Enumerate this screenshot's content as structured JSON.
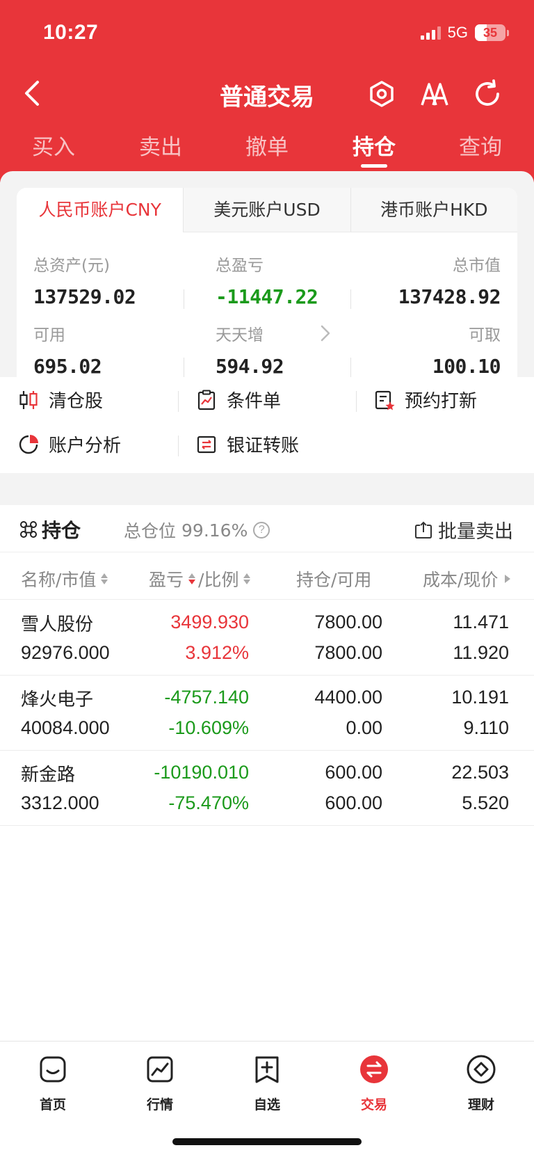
{
  "status": {
    "time": "10:27",
    "network": "5G",
    "battery": "35"
  },
  "nav": {
    "title": "普通交易"
  },
  "tabs": [
    {
      "label": "买入"
    },
    {
      "label": "卖出"
    },
    {
      "label": "撤单"
    },
    {
      "label": "持仓"
    },
    {
      "label": "查询"
    }
  ],
  "active_tab": "持仓",
  "account_tabs": [
    {
      "label": "人民币账户CNY"
    },
    {
      "label": "美元账户USD"
    },
    {
      "label": "港币账户HKD"
    }
  ],
  "stats": {
    "total_assets_label": "总资产(元)",
    "total_assets": "137529.02",
    "total_pnl_label": "总盈亏",
    "total_pnl": "-11447.22",
    "market_value_label": "总市值",
    "market_value": "137428.92",
    "available_label": "可用",
    "available": "695.02",
    "tiantianzeng_label": "天天增",
    "tiantianzeng": "594.92",
    "withdrawable_label": "可取",
    "withdrawable": "100.10"
  },
  "functions": [
    {
      "label": "清仓股",
      "icon": "candlestick-icon"
    },
    {
      "label": "条件单",
      "icon": "clipboard-chart-icon"
    },
    {
      "label": "预约打新",
      "icon": "document-star-icon"
    },
    {
      "label": "账户分析",
      "icon": "pie-chart-icon"
    },
    {
      "label": "银证转账",
      "icon": "transfer-icon"
    }
  ],
  "positions_section": {
    "title": "持仓",
    "ratio_label": "总仓位",
    "ratio": "99.16%",
    "batch_sell": "批量卖出"
  },
  "columns": [
    "名称/市值",
    "盈亏",
    "/比例",
    "持仓/可用",
    "成本/现价"
  ],
  "positions": [
    {
      "name": "雪人股份",
      "market_value": "92976.000",
      "pnl": "3499.930",
      "pnl_pct": "3.912%",
      "holding": "7800.00",
      "available": "7800.00",
      "cost": "11.471",
      "price": "11.920",
      "trend": "up"
    },
    {
      "name": "烽火电子",
      "market_value": "40084.000",
      "pnl": "-4757.140",
      "pnl_pct": "-10.609%",
      "holding": "4400.00",
      "available": "0.00",
      "cost": "10.191",
      "price": "9.110",
      "trend": "down"
    },
    {
      "name": "新金路",
      "market_value": "3312.000",
      "pnl": "-10190.010",
      "pnl_pct": "-75.470%",
      "holding": "600.00",
      "available": "600.00",
      "cost": "22.503",
      "price": "5.520",
      "trend": "down"
    }
  ],
  "bottom_nav": [
    {
      "label": "首页",
      "icon": "home-icon"
    },
    {
      "label": "行情",
      "icon": "market-chart-icon"
    },
    {
      "label": "自选",
      "icon": "watchlist-add-icon"
    },
    {
      "label": "交易",
      "icon": "trade-exchange-icon"
    },
    {
      "label": "理财",
      "icon": "wealth-icon"
    }
  ],
  "bottom_nav_active": "交易",
  "colors": {
    "brand_red": "#e8353a",
    "profit_red": "#e8353a",
    "loss_green": "#1b9a1b"
  }
}
